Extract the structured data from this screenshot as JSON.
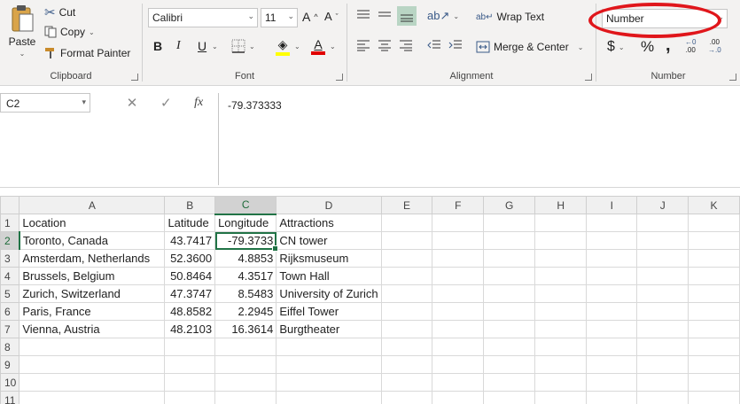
{
  "ribbon": {
    "clipboard": {
      "paste": "Paste",
      "cut": "Cut",
      "copy": "Copy",
      "format_painter": "Format Painter",
      "label": "Clipboard"
    },
    "font": {
      "name": "Calibri",
      "size": "11",
      "bold": "B",
      "italic": "I",
      "underline": "U",
      "font_color_letter": "A",
      "label": "Font"
    },
    "alignment": {
      "wrap_text": "Wrap Text",
      "merge_center": "Merge & Center",
      "label": "Alignment"
    },
    "number": {
      "format": "Number",
      "currency": "$",
      "percent": "%",
      "comma": ",",
      "label": "Number"
    }
  },
  "formula_bar": {
    "name_box": "C2",
    "cancel": "✕",
    "enter": "✓",
    "fx": "fx",
    "formula": "-79.373333"
  },
  "grid": {
    "columns": [
      "A",
      "B",
      "C",
      "D",
      "E",
      "F",
      "G",
      "H",
      "I",
      "J",
      "K"
    ],
    "rows": [
      [
        "Location",
        "Latitude",
        "Longitude",
        "Attractions"
      ],
      [
        "Toronto, Canada",
        "43.7417",
        "-79.3733",
        "CN tower"
      ],
      [
        "Amsterdam, Netherlands",
        "52.3600",
        "4.8853",
        "Rijksmuseum"
      ],
      [
        "Brussels, Belgium",
        "50.8464",
        "4.3517",
        "Town Hall"
      ],
      [
        "Zurich, Switzerland",
        "47.3747",
        "8.5483",
        "University of Zurich"
      ],
      [
        "Paris, France",
        "48.8582",
        "2.2945",
        "Eiffel Tower"
      ],
      [
        "Vienna, Austria",
        "48.2103",
        "16.3614",
        "Burgtheater"
      ]
    ],
    "row_numbers": [
      "1",
      "2",
      "3",
      "4",
      "5",
      "6",
      "7",
      "8",
      "9",
      "10",
      "11"
    ],
    "active_cell": "C2"
  },
  "colors": {
    "accent": "#217346",
    "annotation": "#e0161b"
  }
}
